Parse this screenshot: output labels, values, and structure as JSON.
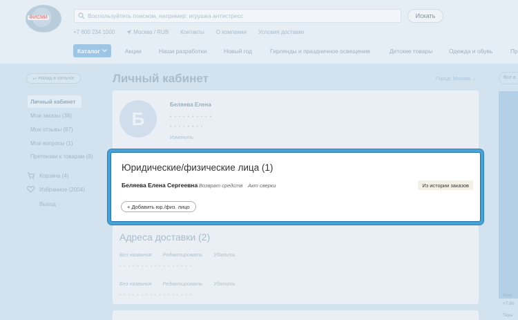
{
  "header": {
    "logo_text": "ФИСМИ",
    "search_placeholder": "Воспользуйтесь поиском, например: игрушка антистресс",
    "search_button": "Искать",
    "phone": "+7 800 234 1000",
    "location": "Москва / RUB",
    "links": [
      "Контакты",
      "О компании",
      "Условия доставки"
    ]
  },
  "menu": {
    "catalog": "Каталог",
    "items": [
      "Акции",
      "Наши разработки",
      "Новый год",
      "Гирлянды и праздничное освещение",
      "Детские товары",
      "Одежда и обувь",
      "Пр"
    ]
  },
  "sidebar": {
    "back": "Назад в каталог",
    "items": [
      "Личный кабинет",
      "Мои заказы (38)",
      "Мои отзывы (87)",
      "Мои вопросы (1)",
      "Претензии к товарам (8)"
    ],
    "cart": "Корзина (4)",
    "favorites": "Избранное (2004)",
    "logout": "Выход"
  },
  "main": {
    "title": "Личный кабинет",
    "city_label": "Город:",
    "city_value": "Москва",
    "profile": {
      "avatar_letter": "Б",
      "name": "Беляева Елена",
      "dots": "• • • • • • • • • •",
      "dots2": "• • • • • • • •",
      "edit": "Изменить"
    },
    "legal": {
      "title": "Юридические/физические лица (1)",
      "person": "Беляева Елена Сергеевна",
      "return_link": "Возврат средств",
      "act_link": "Акт сверки",
      "history": "Из истории заказов",
      "add": "+ Добавить юр./физ. лицо"
    },
    "addresses": {
      "title": "Адреса доставки (2)",
      "rows": [
        {
          "name": "Без названия",
          "edit": "Редактировать",
          "delete": "Удалить"
        },
        {
          "name": "Без названия",
          "edit": "Редактировать",
          "delete": "Удалить"
        }
      ]
    }
  },
  "right_panel": {
    "button": "Все в",
    "consult": "Конс",
    "phone": "+7 80",
    "tech": "Техн"
  }
}
